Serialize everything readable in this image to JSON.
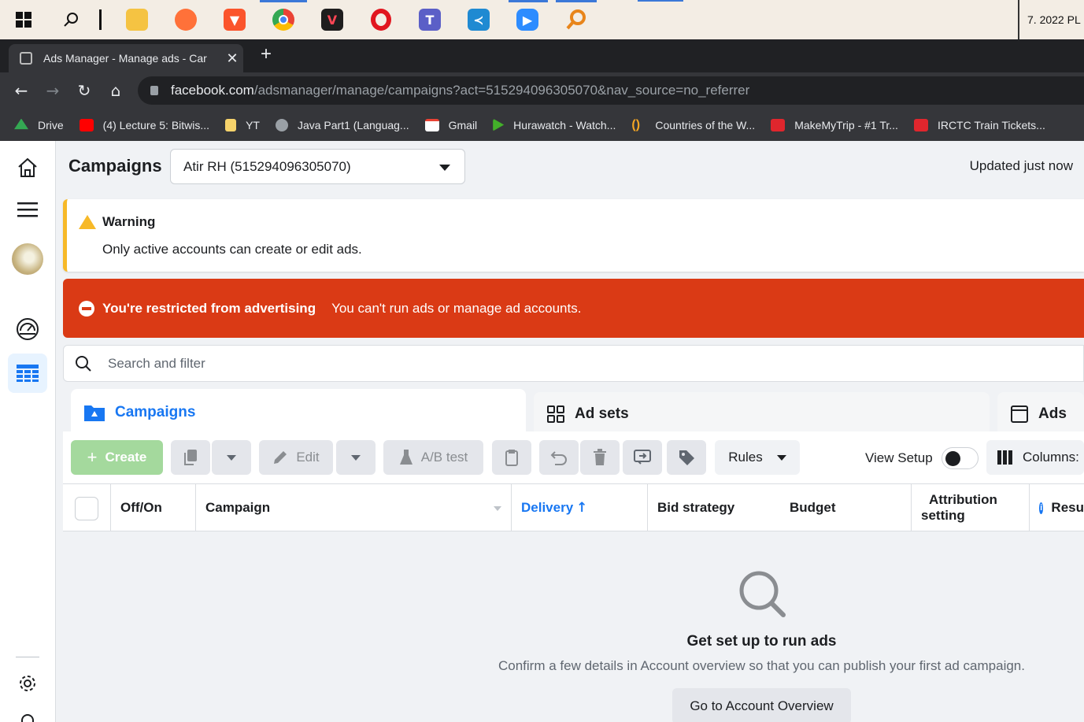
{
  "taskbar": {
    "clock_text": "7. 2022 PL",
    "apps": [
      {
        "icon": "windows-start-icon"
      },
      {
        "icon": "search-icon"
      },
      {
        "icon": "file-explorer-icon"
      },
      {
        "icon": "firefox-icon"
      },
      {
        "icon": "brave-icon"
      },
      {
        "icon": "chrome-icon"
      },
      {
        "icon": "valorant-icon"
      },
      {
        "icon": "opera-icon"
      },
      {
        "icon": "teams-icon"
      },
      {
        "icon": "vscode-icon"
      },
      {
        "icon": "zoom-icon"
      },
      {
        "icon": "search-app-icon"
      }
    ]
  },
  "browser": {
    "tab_title": "Ads Manager - Manage ads - Car",
    "url_host": "facebook.com",
    "url_path": "/adsmanager/manage/campaigns?act=515294096305070&nav_source=no_referrer",
    "bookmarks": [
      {
        "label": "Drive",
        "color": "#34a853"
      },
      {
        "label": "(4) Lecture 5: Bitwis...",
        "color": "#ff0000"
      },
      {
        "label": "YT",
        "color": "#f6d36b"
      },
      {
        "label": "Java Part1 (Languag...",
        "color": "#9aa0a6"
      },
      {
        "label": "Gmail",
        "color": "#ffffff"
      },
      {
        "label": "Hurawatch - Watch...",
        "color": "#43b02a"
      },
      {
        "label": "Countries of the W...",
        "color": "#f5a623"
      },
      {
        "label": "MakeMyTrip - #1 Tr...",
        "color": "#e0262d"
      },
      {
        "label": "IRCTC Train Tickets...",
        "color": "#e0262d"
      }
    ]
  },
  "header": {
    "title": "Campaigns",
    "account": "Atir RH (515294096305070)",
    "updated": "Updated just now"
  },
  "warning": {
    "title": "Warning",
    "message": "Only active accounts can create or edit ads."
  },
  "restriction": {
    "title": "You're restricted from advertising",
    "message": "You can't run ads or manage ad accounts."
  },
  "search": {
    "placeholder": "Search and filter"
  },
  "level_tabs": {
    "campaigns": "Campaigns",
    "adsets": "Ad sets",
    "ads": "Ads"
  },
  "toolbar": {
    "create": "Create",
    "edit": "Edit",
    "ab_test": "A/B test",
    "rules": "Rules",
    "view_setup": "View Setup",
    "columns": "Columns:"
  },
  "table": {
    "headers": {
      "off_on": "Off/On",
      "campaign": "Campaign",
      "delivery": "Delivery",
      "bid_strategy": "Bid strategy",
      "budget": "Budget",
      "attribution_1": "Attribution",
      "attribution_2": "setting",
      "results": "Resu"
    }
  },
  "empty_state": {
    "title": "Get set up to run ads",
    "subtitle": "Confirm a few details in Account overview so that you can publish your first ad campaign.",
    "button": "Go to Account Overview"
  },
  "colors": {
    "brand_blue": "#1877f2",
    "warning_yellow": "#f7b928",
    "restriction_red": "#da3a15",
    "create_green": "#a4d99d"
  }
}
